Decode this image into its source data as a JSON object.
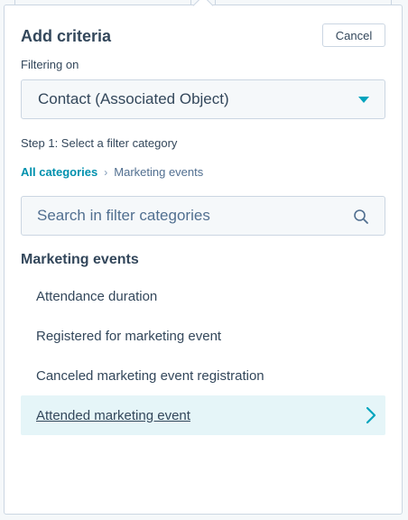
{
  "panel": {
    "title": "Add criteria",
    "cancel_label": "Cancel"
  },
  "filtering": {
    "label": "Filtering on",
    "selected_value": "Contact (Associated Object)"
  },
  "step": {
    "label": "Step 1: Select a filter category"
  },
  "breadcrumb": {
    "root_label": "All categories",
    "separator": "›",
    "current_label": "Marketing events"
  },
  "search": {
    "placeholder": "Search in filter categories"
  },
  "section": {
    "title": "Marketing events",
    "items": [
      {
        "label": "Attendance duration"
      },
      {
        "label": "Registered for marketing event"
      },
      {
        "label": "Canceled marketing event registration"
      },
      {
        "label": "Attended marketing event"
      }
    ]
  },
  "colors": {
    "accent": "#00a4bd",
    "link": "#0091ae",
    "text": "#33475b",
    "border": "#cbd6e2",
    "highlight": "#e5f5f8"
  },
  "icons": {
    "search": "search-icon",
    "dropdown": "caret-down-icon",
    "row_arrow": "chevron-right-icon"
  }
}
